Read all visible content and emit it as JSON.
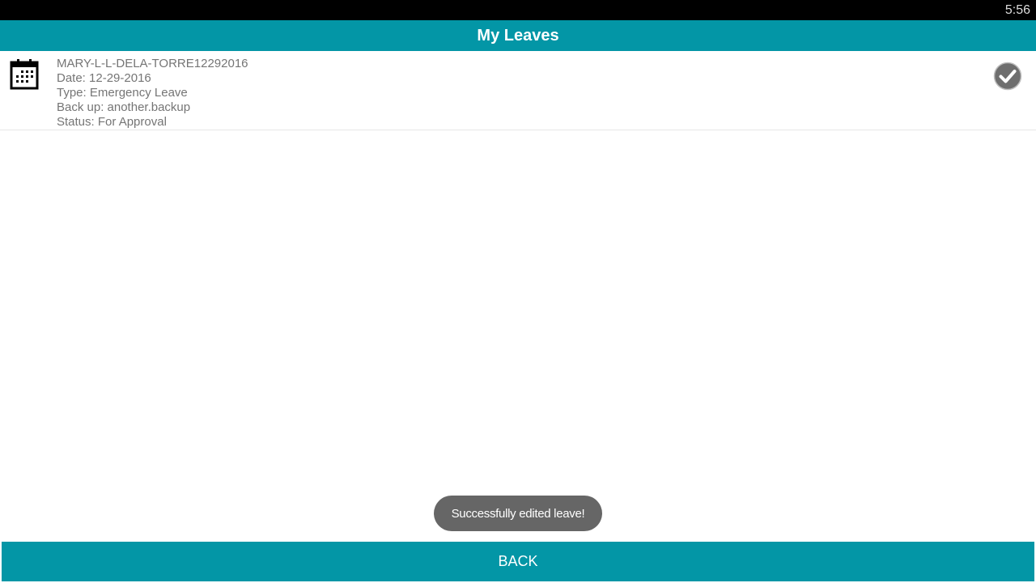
{
  "status_bar": {
    "time": "5:56"
  },
  "app_bar": {
    "title": "My Leaves"
  },
  "leaves": [
    {
      "icon": "calendar-icon",
      "id": "MARY-L-L-DELA-TORRE12292016",
      "date": "Date: 12-29-2016",
      "type": "Type: Emergency Leave",
      "backup": "Back up: another.backup",
      "status": "Status: For Approval",
      "status_icon": "check-circle-icon"
    }
  ],
  "toast": {
    "message": "Successfully edited leave!"
  },
  "footer": {
    "back_label": "BACK"
  },
  "colors": {
    "accent": "#0396a6",
    "toast_bg": "#666666",
    "text_secondary": "#757575"
  }
}
